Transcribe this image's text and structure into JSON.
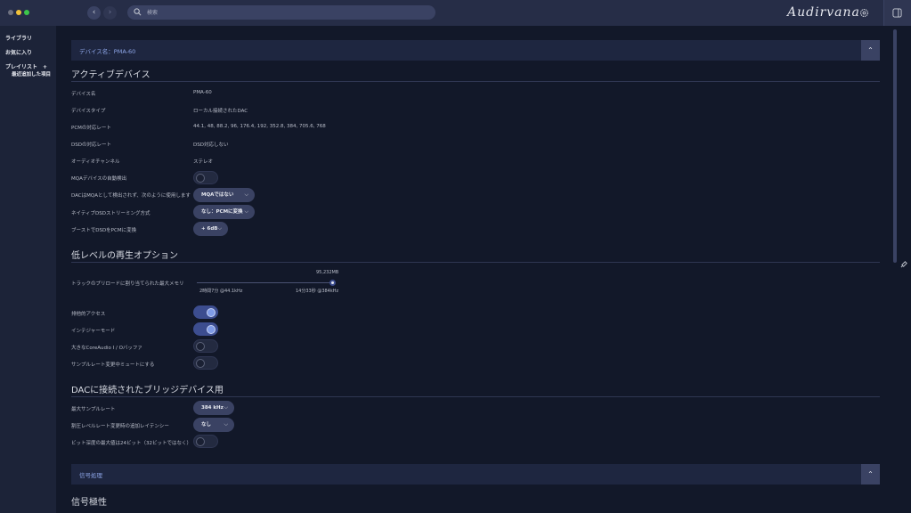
{
  "app": {
    "logo": "Audirvana"
  },
  "search": {
    "placeholder": "検索"
  },
  "sidebar": {
    "items": [
      {
        "label": "ライブラリ"
      },
      {
        "label": "お気に入り"
      },
      {
        "label": "プレイリスト　+"
      }
    ],
    "sub_items": [
      {
        "label": "最近追加した項目"
      }
    ]
  },
  "device_header": {
    "label": "デバイス名：PMA-60"
  },
  "active_device": {
    "title": "アクティブデバイス",
    "rows": [
      {
        "label": "デバイス名",
        "value": "PMA-60"
      },
      {
        "label": "デバイスタイプ",
        "value": "ローカル接続されたDAC"
      },
      {
        "label": "PCMの対応レート",
        "value": "44.1, 48, 88.2, 96, 176.4, 192, 352.8, 384, 705.6, 768"
      },
      {
        "label": "DSDの対応レート",
        "value": "DSD対応しない"
      },
      {
        "label": "オーディオチャンネル",
        "value": "ステレオ"
      }
    ],
    "mqa_detect": {
      "label": "MQAデバイスの自動検出",
      "on": false
    },
    "mqa_mode": {
      "label": "DACはMQAとして検出されず、次のように使用します",
      "value": "MQAではない"
    },
    "native_dsd": {
      "label": "ネイティブDSDストリーミング方式",
      "value": "なし：PCMに変換"
    },
    "dsd_boost": {
      "label": "ブーストでDSDをPCMに変換",
      "value": "+ 6dB"
    }
  },
  "low_level": {
    "title": "低レベルの再生オプション",
    "preload": {
      "label": "トラックのプリロードに割り当てられた最大メモリ",
      "value": "95,232MB",
      "level": 1.0,
      "min_text": "2時間7分 @44.1kHz",
      "max_text": "14分33秒 @384kHz"
    },
    "toggles": [
      {
        "label": "排他的アクセス",
        "on": true
      },
      {
        "label": "インテジャーモード",
        "on": true
      },
      {
        "label": "大きなCoreAudio I / Oバッファ",
        "on": false
      },
      {
        "label": "サンプルレート変更中ミュートにする",
        "on": false
      }
    ]
  },
  "bridge": {
    "title": "DACに接続されたブリッジデバイス用",
    "max_rate": {
      "label": "最大サンプルレート",
      "value": "384 kHz"
    },
    "latency": {
      "label": "割圧レベルレート変更時の追加レイテンシー",
      "value": "なし"
    },
    "max_bits": {
      "label": "ビット深度の最大値は24ビット（32ビットではなく）",
      "on": false
    }
  },
  "signal_header": {
    "label": "信号処理"
  },
  "signal_polarity": {
    "title": "信号極性"
  },
  "icons": {
    "back": "chevron-left-icon",
    "forward": "chevron-right-icon",
    "search": "search-icon",
    "settings": "gear-icon",
    "panel": "panel-icon",
    "collapse": "chevron-up-icon",
    "dropdown": "chevron-down-icon"
  },
  "colors": {
    "accent": "#3c4d8f",
    "accent_light": "#7f9be6",
    "header_text": "#8ea6e8",
    "background": "#121829",
    "sidebar": "#1c2338"
  }
}
